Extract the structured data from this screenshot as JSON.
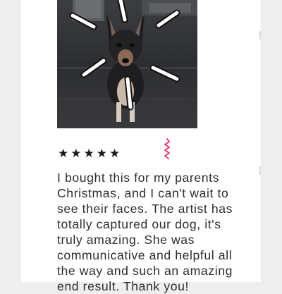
{
  "review": {
    "photo": {
      "subject": "dog portrait with hand-drawn sparkle lines",
      "icon": "dog-photo"
    },
    "rating": {
      "stars": 5,
      "out_of": 5,
      "star_glyph": "★",
      "star_color": "#1a1a1a"
    },
    "accent_icon": {
      "icon": "squiggle-icon",
      "color": "#e8457a"
    },
    "text": "I bought this for my parents\nChristmas, and I can't wait to\nsee their faces. The artist has\ntotally captured our dog, it's\ntruly amazing. She was\ncommunicative and helpful all\nthe way and such an amazing\nend result. Thank you!"
  }
}
